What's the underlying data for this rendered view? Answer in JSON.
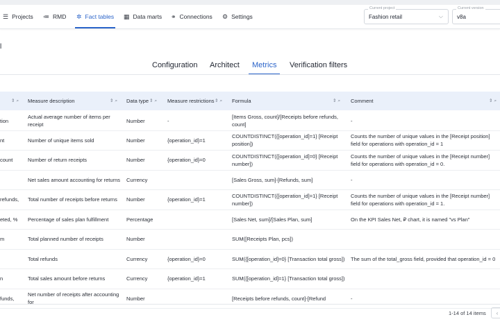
{
  "nav": {
    "items": [
      {
        "icon": "projects-icon",
        "glyph": "☰",
        "label": "Projects"
      },
      {
        "icon": "rmd-icon",
        "glyph": "≔",
        "label": "RMD"
      },
      {
        "icon": "fact-tables-icon",
        "glyph": "✲",
        "label": "Fact tables",
        "active": true
      },
      {
        "icon": "data-marts-icon",
        "glyph": "▦",
        "label": "Data marts"
      },
      {
        "icon": "connections-icon",
        "glyph": "⚭",
        "label": "Connections"
      },
      {
        "icon": "settings-icon",
        "glyph": "⚙",
        "label": "Settings"
      }
    ],
    "project": {
      "label": "Current project",
      "value": "Fashion retail"
    },
    "version": {
      "label": "Current version",
      "value": "v8a"
    }
  },
  "page": {
    "title": "l"
  },
  "tabs": [
    "Configuration",
    "Architect",
    "Metrics",
    "Verification filters"
  ],
  "active_tab": 2,
  "table": {
    "headers": {
      "col0": "",
      "desc": "Measure description",
      "type": "Data type",
      "restr": "Measure restrictions",
      "formula": "Formula",
      "comment": "Comment"
    },
    "rows": [
      {
        "c0": "tion",
        "desc": "Actual average number of items per receipt",
        "type": "Number",
        "restr": "-",
        "formula": "[Items Gross, count]/[Receipts before refunds, count]",
        "comment": "-"
      },
      {
        "c0": "nt",
        "desc": "Number of unique items sold",
        "type": "Number",
        "restr": "{operation_id}=1",
        "formula": "COUNTDISTINCT({[operation_id]=1} [Receipt position])",
        "comment": "Counts the number of unique values in the [Receipt position] field for operations with operation_id = 1"
      },
      {
        "c0": "count",
        "desc": "Number of return receipts",
        "type": "Number",
        "restr": "{operation_id}=0",
        "formula": "COUNTDISTINCT({[operation_id]=0} [Receipt number])",
        "comment": "Counts the number of unique values in the [Receipt number] field for operations with operation_id = 0."
      },
      {
        "c0": "",
        "desc": "Net sales amount accounting for returns",
        "type": "Currency",
        "restr": "",
        "formula": "[Sales Gross, sum]-[Refunds, sum]",
        "comment": "-"
      },
      {
        "c0": "refunds,",
        "desc": "Total number of receipts before returns",
        "type": "Number",
        "restr": "{operation_id}=1",
        "formula": "COUNTDISTINCT({[operation_id]=1} [Receipt number])",
        "comment": "Counts the number of unique values in the [Receipt number] field for operations with operation_id = 1."
      },
      {
        "c0": "eted, %",
        "desc": "Percentage of sales plan fulfillment",
        "type": "Percentage",
        "restr": "",
        "formula": "[Sales Net, sum]/[Sales Plan, sum]",
        "comment": "On the KPI Sales Net, ₽ chart, it is named \"vs Plan\""
      },
      {
        "c0": "m",
        "desc": "Total planned number of receipts",
        "type": "Number",
        "restr": "",
        "formula": "SUM([Receipts Plan, pcs])",
        "comment": ""
      },
      {
        "c0": "",
        "desc": "Total refunds",
        "type": "Currency",
        "restr": "{operation_id}=0",
        "formula": "SUM({[operation_id]=0} [Transaction total gross])",
        "comment": "The sum of the total_gross field, provided that operation_id = 0"
      },
      {
        "c0": "n",
        "desc": "Total sales amount before returns",
        "type": "Currency",
        "restr": "{operation_id}=1",
        "formula": "SUM({[operation_id]=1} [Transaction total gross])",
        "comment": ""
      },
      {
        "c0": "funds,",
        "desc": "Net number of receipts after accounting for",
        "type": "Number",
        "restr": "",
        "formula": "[Receipts before refunds, count]-[Refund",
        "comment": "-"
      }
    ]
  },
  "pager": {
    "text": "1-14 of 14 items",
    "prev": "‹"
  }
}
